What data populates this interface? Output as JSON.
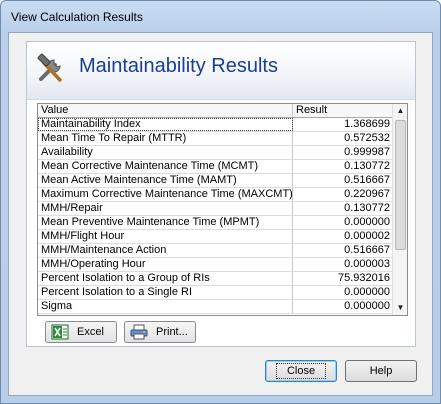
{
  "window": {
    "title": "View Calculation Results"
  },
  "banner": {
    "title": "Maintainability Results",
    "icon": "tools-icon"
  },
  "grid": {
    "headers": {
      "value": "Value",
      "result": "Result"
    },
    "rows": [
      {
        "name": "Maintainability Index",
        "value": "1.368699"
      },
      {
        "name": "Mean Time To Repair (MTTR)",
        "value": "0.572532"
      },
      {
        "name": "Availability",
        "value": "0.999987"
      },
      {
        "name": "Mean Corrective Maintenance Time (MCMT)",
        "value": "0.130772"
      },
      {
        "name": "Mean Active Maintenance Time (MAMT)",
        "value": "0.516667"
      },
      {
        "name": "Maximum Corrective Maintenance Time (MAXCMT)",
        "value": "0.220967"
      },
      {
        "name": "MMH/Repair",
        "value": "0.130772"
      },
      {
        "name": "Mean Preventive Maintenance Time (MPMT)",
        "value": "0.000000"
      },
      {
        "name": "MMH/Flight Hour",
        "value": "0.000002"
      },
      {
        "name": "MMH/Maintenance Action",
        "value": "0.516667"
      },
      {
        "name": "MMH/Operating Hour",
        "value": "0.000003"
      },
      {
        "name": "Percent Isolation to a Group of RIs",
        "value": "75.932016"
      },
      {
        "name": "Percent Isolation to a Single RI",
        "value": "0.000000"
      },
      {
        "name": "Sigma",
        "value": "0.000000"
      }
    ]
  },
  "buttons": {
    "excel": "Excel",
    "print": "Print...",
    "close": "Close",
    "help": "Help"
  }
}
